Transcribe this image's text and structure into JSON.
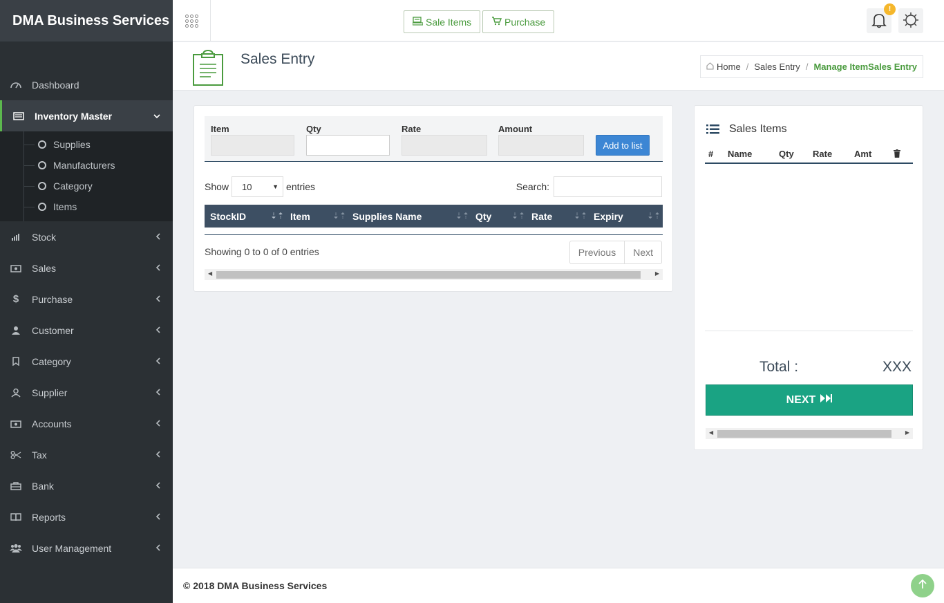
{
  "app": {
    "brand": "DMA Business Services"
  },
  "topbar": {
    "sale_items_label": "Sale Items",
    "purchase_label": "Purchase",
    "notification_badge": "!"
  },
  "sidebar": {
    "items": [
      {
        "label": "Dashboard",
        "icon": "dashboard-icon"
      },
      {
        "label": "Inventory Master",
        "icon": "inventory-icon",
        "active": true
      },
      {
        "label": "Stock",
        "icon": "bar-chart-icon"
      },
      {
        "label": "Sales",
        "icon": "money-icon"
      },
      {
        "label": "Purchase",
        "icon": "dollar-icon"
      },
      {
        "label": "Customer",
        "icon": "user-icon"
      },
      {
        "label": "Category",
        "icon": "tag-icon"
      },
      {
        "label": "Supplier",
        "icon": "person-icon"
      },
      {
        "label": "Accounts",
        "icon": "money-icon"
      },
      {
        "label": "Tax",
        "icon": "scissors-icon"
      },
      {
        "label": "Bank",
        "icon": "briefcase-icon"
      },
      {
        "label": "Reports",
        "icon": "book-icon"
      },
      {
        "label": "User Management",
        "icon": "users-icon"
      }
    ],
    "sub_items": [
      "Supplies",
      "Manufacturers",
      "Category",
      "Items"
    ]
  },
  "page": {
    "title": "Sales Entry",
    "breadcrumb": {
      "home": "Home",
      "level1": "Sales Entry",
      "current": "Manage ItemSales Entry"
    }
  },
  "entry_form": {
    "item_label": "Item",
    "qty_label": "Qty",
    "rate_label": "Rate",
    "amount_label": "Amount",
    "add_button": "Add to list"
  },
  "table": {
    "show_label": "Show",
    "page_size": "10",
    "entries_label": "entries",
    "search_label": "Search:",
    "columns": [
      "StockID",
      "Item",
      "Supplies Name",
      "Qty",
      "Rate",
      "Expiry"
    ],
    "info": "Showing 0 to 0 of 0 entries",
    "prev": "Previous",
    "next": "Next"
  },
  "sales_items": {
    "title": "Sales Items",
    "columns": [
      "#",
      "Name",
      "Qty",
      "Rate",
      "Amt"
    ],
    "total_label": "Total :",
    "total_value": "XXX",
    "next_button": "NEXT"
  },
  "footer": {
    "text": "© 2018 DMA Business Services"
  },
  "colors": {
    "accent_green": "#4a9b3e",
    "table_header": "#3d4f63",
    "next_teal": "#1aa383",
    "add_blue": "#3c86d4"
  }
}
